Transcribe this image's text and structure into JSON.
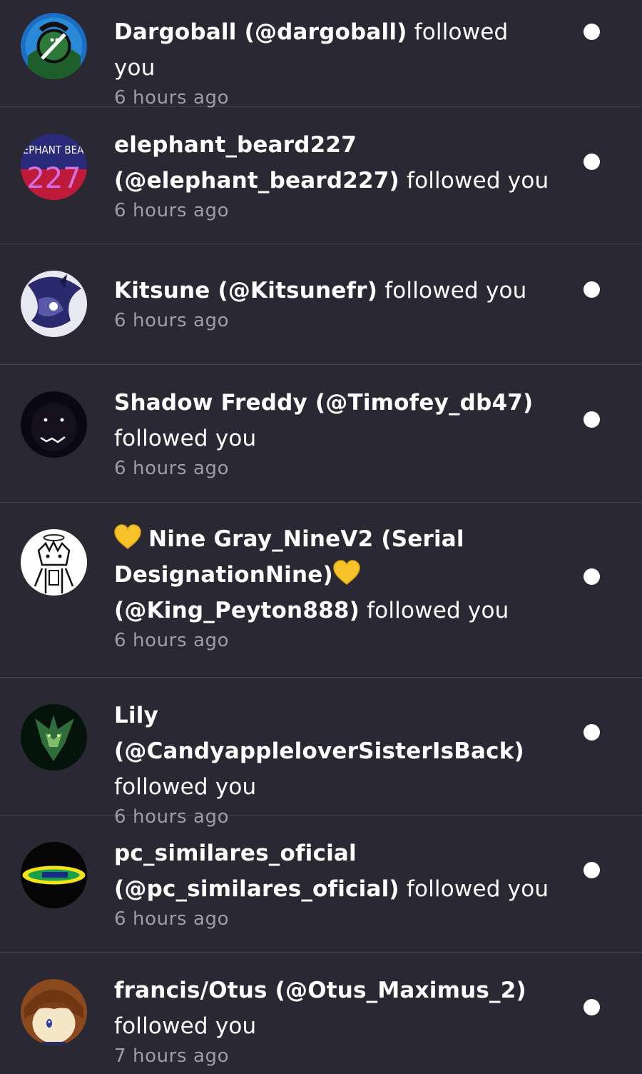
{
  "notifications": [
    {
      "name": "Dargoball (@dargoball)",
      "action": "followed you",
      "time": "6 hours ago",
      "avatar": "dargoball-avatar"
    },
    {
      "name_line1": "elephant_beard227",
      "name_line2": "(@elephant_beard227)",
      "action": "followed you",
      "time": "6 hours ago",
      "avatar_text_top": "LEPHANT BEAR",
      "avatar_text_bottom": "227"
    },
    {
      "name": "Kitsune (@Kitsunefr)",
      "action": "followed you",
      "time": "6 hours ago",
      "avatar": "kitsune-avatar"
    },
    {
      "name": "Shadow Freddy (@Timofey_db47)",
      "action": "followed you",
      "time": "6 hours ago",
      "avatar": "shadow-freddy-avatar"
    },
    {
      "name_part1": "Nine Gray_NineV2 (Serial",
      "name_part2": "DesignationNine)",
      "name_part3": "(@King_Peyton888)",
      "action": "followed you",
      "time": "6 hours ago",
      "emoji": "yellow-heart"
    },
    {
      "name": "Lily (@CandyappleloverSisterIsBack)",
      "action": "followed you",
      "time": "6 hours ago",
      "avatar": "lily-avatar"
    },
    {
      "name_line1": "pc_similares_oficial",
      "name_line2": "(@pc_similares_oficial)",
      "action": "followed you",
      "time": "6 hours ago",
      "avatar": "pc-similares-avatar"
    },
    {
      "name": "francis/Otus (@Otus_Maximus_2)",
      "action": "followed you",
      "time": "7 hours ago",
      "avatar": "francis-otus-avatar"
    }
  ],
  "colors": {
    "background": "#2a2933",
    "divider": "#44434c",
    "text": "#ffffff",
    "muted": "#9e9da6",
    "unread_dot": "#ffffff"
  }
}
